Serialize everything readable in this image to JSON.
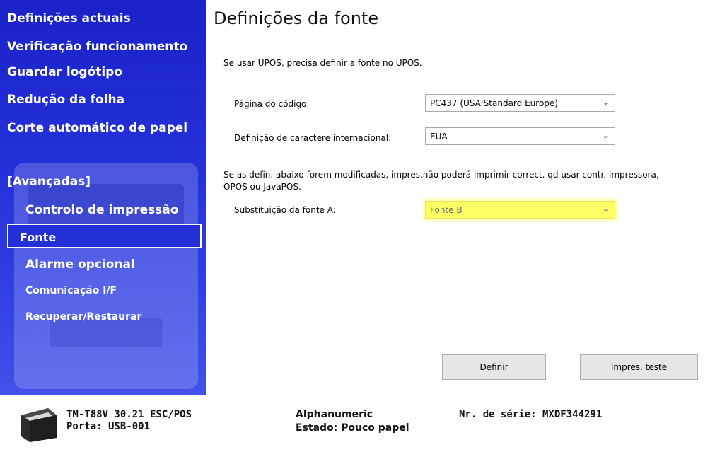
{
  "sidebar": {
    "items": [
      {
        "label": "Definições actuais"
      },
      {
        "label": "Verificação funcionamento"
      },
      {
        "label": "Guardar logótipo"
      },
      {
        "label": "Redução da folha"
      },
      {
        "label": "Corte automático de papel"
      }
    ],
    "advanced_header": "[Avançadas]",
    "advanced_items": [
      {
        "label": "Controlo de impressão"
      },
      {
        "label": "Fonte"
      },
      {
        "label": "Alarme opcional"
      },
      {
        "label": "Comunicação I/F"
      },
      {
        "label": "Recuperar/Restaurar"
      }
    ]
  },
  "main": {
    "title": "Definições da fonte",
    "upos_note": "Se usar UPOS, precisa definir a fonte no UPOS.",
    "code_page_label": "Página do código:",
    "code_page_value": "PC437 (USA:Standard Europe)",
    "intl_label": "Definição de caractere internacional:",
    "intl_value": "EUA",
    "warning_line1": "Se as defin. abaixo forem modificadas, impres.não poderá imprimir correct. qd usar contr. impressora,",
    "warning_line2": "OPOS ou JavaPOS.",
    "font_a_label": "Substituição da fonte A:",
    "font_a_value": "Fonte B",
    "define_button": "Definir",
    "test_button": "Impres. teste"
  },
  "footer": {
    "model": "TM-T88V 30.21 ESC/POS",
    "port": "Porta: USB-001",
    "type": "Alphanumeric",
    "status": "Estado: Pouco papel",
    "serial": "Nr. de série: MXDF344291"
  },
  "colors": {
    "sidebar_blue": "#2430d8",
    "highlight": "#ffff66"
  }
}
